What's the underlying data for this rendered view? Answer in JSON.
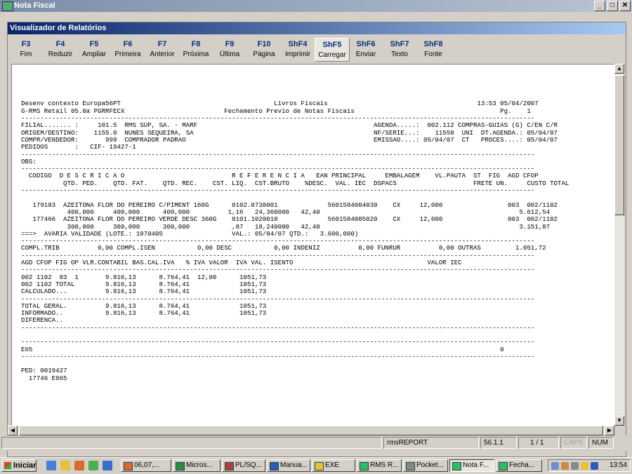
{
  "window": {
    "title": "Nota Fiscal",
    "buttons": [
      "_",
      "□",
      "✕"
    ]
  },
  "viewer": {
    "title": "Visualizador de Relatórios"
  },
  "fkeys": [
    {
      "key": "F3",
      "label": "Fim"
    },
    {
      "key": "F4",
      "label": "Reduzir"
    },
    {
      "key": "F5",
      "label": "Ampliar"
    },
    {
      "key": "F6",
      "label": "Primeira"
    },
    {
      "key": "F7",
      "label": "Anterior"
    },
    {
      "key": "F8",
      "label": "Próxima"
    },
    {
      "key": "F9",
      "label": "Última"
    },
    {
      "key": "F10",
      "label": "Página"
    },
    {
      "key": "ShF4",
      "label": "Imprimir"
    },
    {
      "key": "ShF5",
      "label": "Carregar"
    },
    {
      "key": "ShF6",
      "label": "Enviar"
    },
    {
      "key": "ShF7",
      "label": "Texto"
    },
    {
      "key": "ShF8",
      "label": "Fonte"
    }
  ],
  "report": {
    "lines": [
      "",
      "",
      "",
      "",
      "",
      "Desenv contexto Europa56PT                                        Livros Fiscais                                       13:53 05/04/2007",
      "G-RMS Retail 05.0a PGRRFECX                          Fechamento Previo de Notas Fiscais                                      Pg.    1",
      "--------------------------------------------------------------------------------------------------------------------------------------",
      "FILIAL....... :     101.5  RMS SUP, SA. - MARF                                              AGENDA.....:  002.112 COMPRAS-GUIAS (G) C/EN C/R",
      "ORIGEM/DESTINO:    1155.0  NUNES SEQUEIRA, SA                                               NF/SERIE...:    11550  UNI  DT.AGENDA.: 05/04/07",
      "COMPR/VENDEDOR:       999  COMPRADOR PADRAO                                                 EMISSAO....: 05/04/07  CT   PROCES....: 05/04/07",
      "PEDIDOS       :   CIF- 19427-1",
      "--------------------------------------------------------------------------------------------------------------------------------------",
      "OBS:",
      "--------------------------------------------------------------------------------------------------------------------------------------",
      "  CODIGO  D E S C R I C A O                            R E F E R E N C I A   EAN PRINCIPAL     EMBALAGEM    VL.PAUTA  ST  FIG  AGD CFOP",
      "           QTD. PED.    QTD. FAT.    QTD. REC.    CST. LIQ.  CST.BRUTO    %DESC.  VAL. IEC  DSPACS                    FRETE UN.     CUSTO TOTAL",
      "--------------------------------------------------------------------------------------------------------------------------------------",
      "",
      "   179183  AZEITONA FLOR DO PEREIRO C/PIMENT 160G      0102.0738001             5601584004030    CX     12,000                 003  002/1102",
      "            400,000     400,000      400,000          1,16   24,360000   42,40                                                    5.612,54",
      "   177466  AZEITONA FLOR DO PEREIRO VERDE DESC 360G    0101.1020010             5601584005020    CX     12,000                 003  002/1102",
      "            300,000     300,000      300,000           ,87   18,240000   42,40                                                    3.151,87",
      "===>  AVARIA VALIDADE (LOTE.: 1070405                  VAL.: 05/04/07 QTD.:   3.600,000)",
      "--------------------------------------------------------------------------------------------------------------------------------------",
      "COMPL.TRIB          0,00 COMPL.ISEN           0,00 DESC           0,00 INDENIZ          0,00 FUNRUR          0,00 OUTRAS         1.051,72",
      "--------------------------------------------------------------------------------------------------------------------------------------",
      "AGD CFOP FIG OP VLR.CONTABIL BAS.CAL.IVA   % IVA VALOR  IVA VAL. ISENTO                                   VALOR IEC",
      "--------------------------------------------------------------------------------------------------------------------------------------",
      "002 1102  03  1       9.816,13      8.764,41  12,00      1051,73",
      "002 1102 TOTAL        9.816,13      8.764,41             1051,73",
      "CALCULADO...          9.816,13      8.764,41             1051,73",
      "--------------------------------------------------------------------------------------------------------------------------------------",
      "TOTAL GERAL.          9.816,13      8.764,41             1051,73",
      "INFORMADO..           9.816,13      8.764,41             1051,73",
      "DIFERENCA..",
      "--------------------------------------------------------------------------------------------------------------------------------------",
      "",
      "--------------------------------------------------------------------------------------------------------------------------------------",
      "E65                                                                                                                          0",
      "--------------------------------------------------------------------------------------------------------------------------------------",
      "",
      "PED: 0019427",
      "  17746 E065"
    ]
  },
  "status": {
    "left": "",
    "app": "rmsREPORT",
    "version": "56.1.1",
    "page": "1 / 1",
    "caps": "CAPS",
    "num": "NUM"
  },
  "taskbar": {
    "start": "Iniciar",
    "tasks": [
      "06,07,...",
      "Micros...",
      "PL/SQ...",
      "Manua...",
      "EXE",
      "RMS R...",
      "Pocket...",
      "Nota F...",
      "Fecha..."
    ],
    "clock": "13:54"
  }
}
